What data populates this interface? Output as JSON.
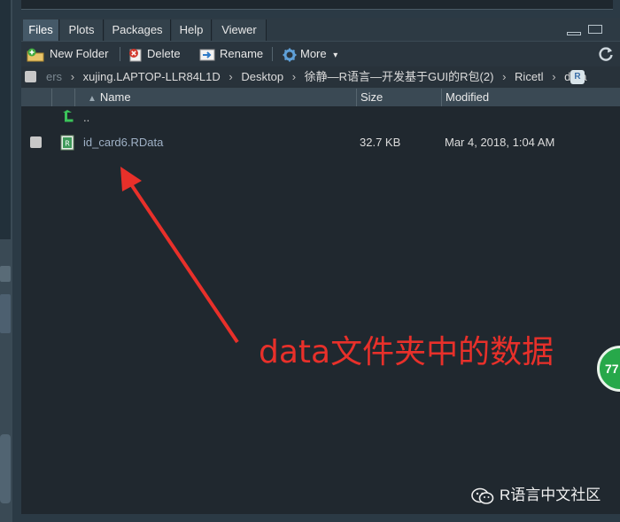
{
  "tabs": [
    "Files",
    "Plots",
    "Packages",
    "Help",
    "Viewer"
  ],
  "active_tab": "Files",
  "toolbar": {
    "new_folder": "New Folder",
    "delete": "Delete",
    "rename": "Rename",
    "more": "More",
    "more_arrow": "▾"
  },
  "breadcrumb": {
    "items": [
      "ers",
      "xujing.LAPTOP-LLR84L1D",
      "Desktop",
      "徐静—R语言—开发基于GUI的R包(2)",
      "Ricetl",
      "data"
    ],
    "separator": "›",
    "r_badge": "R"
  },
  "columns": {
    "name": "Name",
    "size": "Size",
    "modified": "Modified",
    "sort_arrow": "▲"
  },
  "rows": [
    {
      "name": "..",
      "size": "",
      "modified": "",
      "type": "parent"
    },
    {
      "name": "id_card6.RData",
      "size": "32.7 KB",
      "modified": "Mar 4, 2018, 1:04 AM",
      "type": "rdata"
    }
  ],
  "annotation": "data文件夹中的数据",
  "badge_text": "77",
  "watermark": "R语言中文社区",
  "colors": {
    "accent_red": "#e8302a",
    "pane_bg": "#20282f",
    "link_blue": "#9fb1c6",
    "badge_green": "#27a84a"
  }
}
